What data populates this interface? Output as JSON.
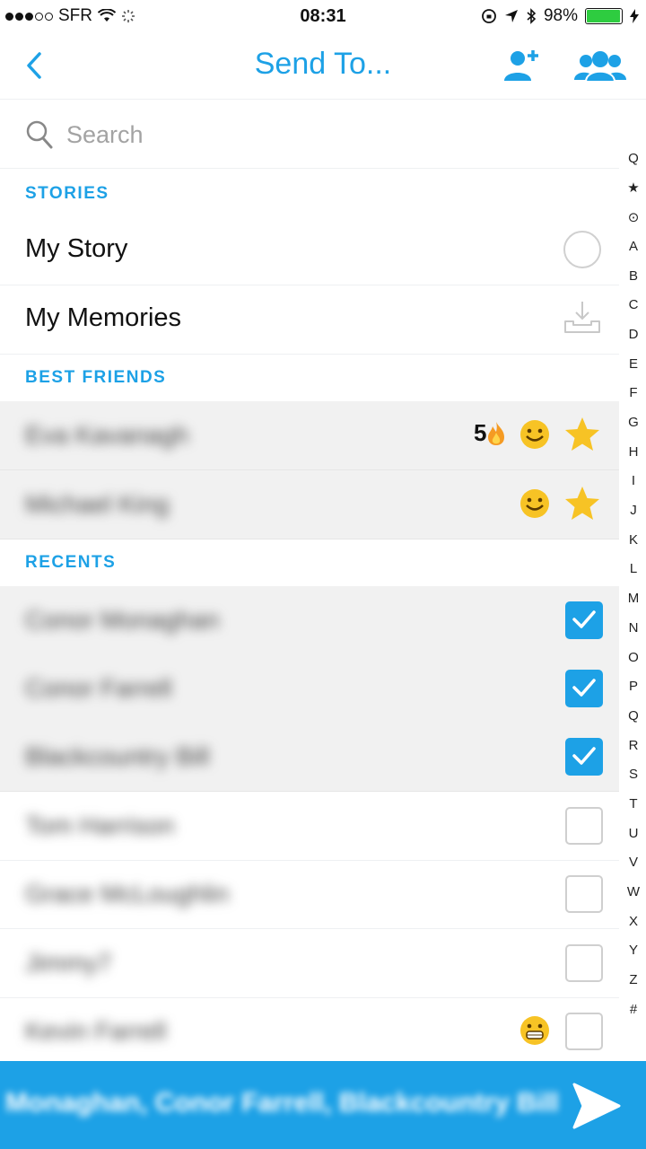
{
  "status": {
    "carrier": "SFR",
    "time": "08:31",
    "battery": "98%",
    "signal_bars": 3
  },
  "header": {
    "title": "Send To..."
  },
  "search": {
    "placeholder": "Search"
  },
  "sections": {
    "stories": "STORIES",
    "best_friends": "BEST FRIENDS",
    "recents": "RECENTS"
  },
  "stories": [
    {
      "label": "My Story"
    },
    {
      "label": "My Memories"
    }
  ],
  "best_friends": [
    {
      "name": "Eva Kavanagh",
      "streak": "5",
      "star": true
    },
    {
      "name": "Michael King",
      "star": true
    }
  ],
  "recents": [
    {
      "name": "Conor Monaghan",
      "checked": true
    },
    {
      "name": "Conor Farrell",
      "checked": true
    },
    {
      "name": "Blackcountry Bill",
      "checked": true
    },
    {
      "name": "Tom Harrison",
      "checked": false
    },
    {
      "name": "Grace McLoughlin",
      "checked": false
    },
    {
      "name": "Jimmy7",
      "checked": false
    },
    {
      "name": "Kevin Farrell",
      "checked": false,
      "emoji": "grimace"
    }
  ],
  "alphabet": [
    "Q",
    "★",
    "⊙",
    "A",
    "B",
    "C",
    "D",
    "E",
    "F",
    "G",
    "H",
    "I",
    "J",
    "K",
    "L",
    "M",
    "N",
    "O",
    "P",
    "Q",
    "R",
    "S",
    "T",
    "U",
    "V",
    "W",
    "X",
    "Y",
    "Z",
    "#"
  ],
  "send_bar": {
    "recipients": "Monaghan, Conor Farrell, Blackcountry Bill"
  },
  "colors": {
    "accent": "#1da1e6",
    "row_selected": "#f1f1f1",
    "star": "#f7c325"
  }
}
